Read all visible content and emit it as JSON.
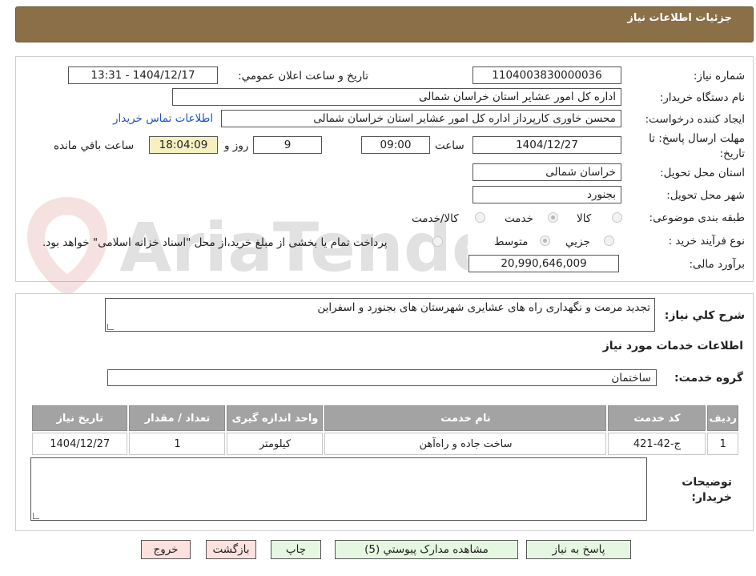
{
  "header": {
    "title": "جزئیات اطلاعات نیاز"
  },
  "form": {
    "need_number_label": "شماره نیاز:",
    "need_number": "1104003830000036",
    "announce_label": "تاریخ و ساعت اعلان عمومي:",
    "announce_value": "1404/12/17 - 13:31",
    "buyer_org_label": "نام دستگاه خریدار:",
    "buyer_org": "اداره کل امور عشایر استان خراسان شمالی",
    "requester_label": "ایجاد کننده درخواست:",
    "requester": "محسن خاوری کارپرداز اداره کل امور عشایر استان خراسان شمالی",
    "contact_link": "اطلاعات تماس خریدار",
    "deadline_label_line1": "مهلت ارسال پاسخ: تا",
    "deadline_label_line2": "تاریخ:",
    "deadline_date": "1404/12/27",
    "time_label": "ساعت",
    "deadline_time": "09:00",
    "days_value": "9",
    "days_label": "روز و",
    "remaining_time": "18:04:09",
    "remaining_label": "ساعت باقي مانده",
    "province_label": "استان محل تحویل:",
    "province": "خراسان شمالی",
    "city_label": "شهر محل تحویل:",
    "city": "بجنورد",
    "category_label": "طبقه بندی موضوعی:",
    "category_options": [
      "کالا",
      "خدمت",
      "کالا/خدمت"
    ],
    "category_selected": "خدمت",
    "process_label": "نوع فرآیند خرید :",
    "process_options": [
      "جزيي",
      "متوسط"
    ],
    "process_selected": "متوسط",
    "payment_note": "پرداخت تمام یا بخشی از مبلغ خرید،از محل \"اسناد خزانه اسلامی\" خواهد بود.",
    "budget_label": "برآورد مالی:",
    "budget": "20,990,646,009"
  },
  "details": {
    "description_label": "شرح کلي نياز:",
    "description": "تجدید مرمت و نگهداری راه های عشایری شهرستان های بجنورد و اسفراین",
    "services_heading": "اطلاعات خدمات مورد نياز",
    "service_group_label": "گروه خدمت:",
    "service_group": "ساختمان",
    "table": {
      "headers": [
        "ردیف",
        "کد خدمت",
        "نام خدمت",
        "واحد اندازه گیری",
        "تعداد / مقدار",
        "تاریخ نیاز"
      ],
      "rows": [
        [
          "1",
          "ج-42-421",
          "ساخت جاده و راه‌آهن",
          "کیلومتر",
          "1",
          "1404/12/27"
        ]
      ]
    },
    "buyer_notes_label_line1": "توضیحات",
    "buyer_notes_label_line2": "خریدار:",
    "buyer_notes": ""
  },
  "buttons": {
    "reply": "پاسخ به نیاز",
    "attachments": "مشاهده مدارک پیوستي (5)",
    "print": "چاپ",
    "back": "بازگشت",
    "exit": "خروج"
  },
  "watermark_text": "AriaTender.neT",
  "colors": {
    "header": "#8b6f47",
    "link": "#1a55c2",
    "remaining_bg": "#f4f0c0",
    "green_button": "#e6f7e1",
    "pink_button": "#fde1df"
  }
}
